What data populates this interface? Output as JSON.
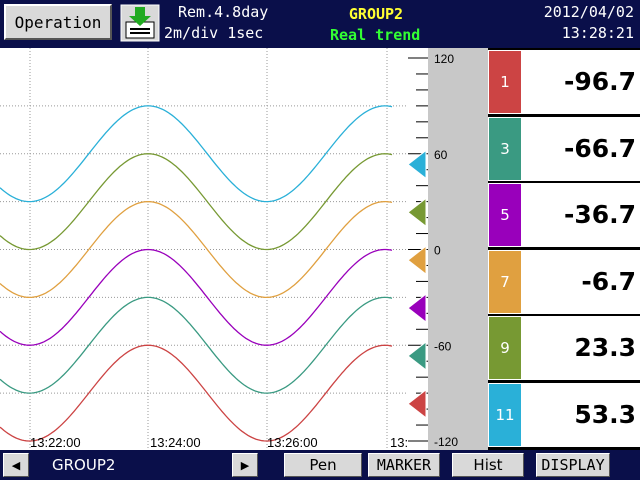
{
  "header": {
    "operation_label": "Operation",
    "remaining": "Rem.4.8day",
    "interval": "2m/div 1sec",
    "group": "GROUP2",
    "mode": "Real trend",
    "date": "2012/04/02",
    "time": "13:28:21",
    "save_icon": "save-download-icon"
  },
  "chart_data": {
    "type": "line",
    "ylim": [
      -120,
      120
    ],
    "scale_ticks": [
      "120",
      "60",
      "0",
      "-60",
      "-120"
    ],
    "time_labels": [
      "13:22:00",
      "13:24:00",
      "13:26:00",
      "13:"
    ],
    "grid": true,
    "series": [
      {
        "name": "1",
        "color": "#cc4444",
        "offset": -90
      },
      {
        "name": "3",
        "color": "#3a9a82",
        "offset": -60
      },
      {
        "name": "5",
        "color": "#9900bb",
        "offset": -30
      },
      {
        "name": "7",
        "color": "#e0a040",
        "offset": 0
      },
      {
        "name": "9",
        "color": "#779933",
        "offset": 30
      },
      {
        "name": "11",
        "color": "#2ab0d8",
        "offset": 60
      }
    ]
  },
  "channels": [
    {
      "id": "1",
      "value": "-96.7",
      "color": "#cc4444"
    },
    {
      "id": "3",
      "value": "-66.7",
      "color": "#3a9a82"
    },
    {
      "id": "5",
      "value": "-36.7",
      "color": "#9900bb"
    },
    {
      "id": "7",
      "value": "-6.7",
      "color": "#e0a040"
    },
    {
      "id": "9",
      "value": "23.3",
      "color": "#779933"
    },
    {
      "id": "11",
      "value": "53.3",
      "color": "#2ab0d8"
    }
  ],
  "footer": {
    "left_arrow": "◀",
    "group_name": "GROUP2",
    "right_arrow": "▶",
    "pen": "Pen",
    "marker": "MARKER",
    "hist": "Hist",
    "display": "DISPLAY"
  }
}
